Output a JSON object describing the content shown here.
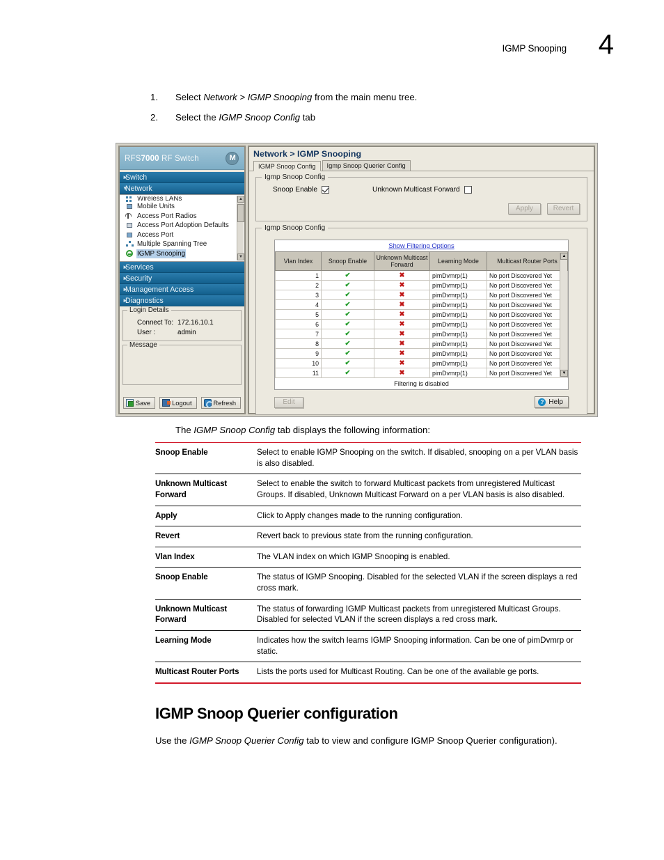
{
  "page": {
    "running_head": "IGMP Snooping",
    "chapter_number": "4"
  },
  "steps": [
    {
      "num": "1.",
      "pre": "Select ",
      "em1": "Network > IGMP Snooping",
      "post": " from the main menu tree."
    },
    {
      "num": "2.",
      "pre": "Select the ",
      "em1": "IGMP Snoop Config",
      "post": " tab"
    }
  ],
  "screenshot": {
    "brand": {
      "prefix": "RFS",
      "bold": "7000",
      "suffix": " RF Switch",
      "logo": "motorola-logo-icon"
    },
    "nav_groups": [
      {
        "label": "Switch",
        "expanded": false
      },
      {
        "label": "Network",
        "expanded": true
      },
      {
        "label": "Services",
        "expanded": false
      },
      {
        "label": "Security",
        "expanded": false
      },
      {
        "label": "Management Access",
        "expanded": false
      },
      {
        "label": "Diagnostics",
        "expanded": false
      }
    ],
    "tree_items": [
      {
        "label": "Wireless LANs",
        "selected": false,
        "icon": "wireless-lan-icon",
        "clipped": true
      },
      {
        "label": "Mobile Units",
        "selected": false,
        "icon": "mobile-unit-icon",
        "clipped": false
      },
      {
        "label": "Access Port Radios",
        "selected": false,
        "icon": "antenna-icon",
        "clipped": false
      },
      {
        "label": "Access Port Adoption Defaults",
        "selected": false,
        "icon": "adoption-defaults-icon",
        "clipped": false
      },
      {
        "label": "Access Port",
        "selected": false,
        "icon": "access-port-icon",
        "clipped": false
      },
      {
        "label": "Multiple Spanning Tree",
        "selected": false,
        "icon": "spanning-tree-icon",
        "clipped": false
      },
      {
        "label": "IGMP Snooping",
        "selected": true,
        "icon": "igmp-snooping-icon",
        "clipped": false
      }
    ],
    "login_details": {
      "legend": "Login Details",
      "connect_to_label": "Connect To:",
      "connect_to_value": "172.16.10.1",
      "user_label": "User :",
      "user_value": "admin"
    },
    "message_legend": "Message",
    "footer_buttons": [
      {
        "label": "Save",
        "icon": "save-icon"
      },
      {
        "label": "Logout",
        "icon": "logout-icon"
      },
      {
        "label": "Refresh",
        "icon": "refresh-icon"
      }
    ],
    "breadcrumb": "Network > IGMP Snooping",
    "tabs": [
      {
        "label": "IGMP Snoop Config",
        "active": true
      },
      {
        "label": "Igmp Snoop Querier Config",
        "active": false
      }
    ],
    "config_group": {
      "legend": "Igmp Snoop Config",
      "snoop_enable_label": "Snoop Enable",
      "snoop_enable_checked": true,
      "unknown_mcast_label": "Unknown Multicast Forward",
      "unknown_mcast_checked": false,
      "apply_label": "Apply",
      "revert_label": "Revert"
    },
    "table_group": {
      "legend": "Igmp Snoop Config",
      "filter_link": "Show Filtering Options",
      "columns": [
        "Vlan Index",
        "Snoop Enable",
        "Unknown Multicast Forward",
        "Learning Mode",
        "Multicast Router Ports"
      ],
      "rows": [
        {
          "vlan": "1",
          "snoop": "check",
          "umf": "cross",
          "mode": "pimDvmrp(1)",
          "ports": "No port Discovered Yet"
        },
        {
          "vlan": "2",
          "snoop": "check",
          "umf": "cross",
          "mode": "pimDvmrp(1)",
          "ports": "No port Discovered Yet"
        },
        {
          "vlan": "3",
          "snoop": "check",
          "umf": "cross",
          "mode": "pimDvmrp(1)",
          "ports": "No port Discovered Yet"
        },
        {
          "vlan": "4",
          "snoop": "check",
          "umf": "cross",
          "mode": "pimDvmrp(1)",
          "ports": "No port Discovered Yet"
        },
        {
          "vlan": "5",
          "snoop": "check",
          "umf": "cross",
          "mode": "pimDvmrp(1)",
          "ports": "No port Discovered Yet"
        },
        {
          "vlan": "6",
          "snoop": "check",
          "umf": "cross",
          "mode": "pimDvmrp(1)",
          "ports": "No port Discovered Yet"
        },
        {
          "vlan": "7",
          "snoop": "check",
          "umf": "cross",
          "mode": "pimDvmrp(1)",
          "ports": "No port Discovered Yet"
        },
        {
          "vlan": "8",
          "snoop": "check",
          "umf": "cross",
          "mode": "pimDvmrp(1)",
          "ports": "No port Discovered Yet"
        },
        {
          "vlan": "9",
          "snoop": "check",
          "umf": "cross",
          "mode": "pimDvmrp(1)",
          "ports": "No port Discovered Yet"
        },
        {
          "vlan": "10",
          "snoop": "check",
          "umf": "cross",
          "mode": "pimDvmrp(1)",
          "ports": "No port Discovered Yet"
        },
        {
          "vlan": "11",
          "snoop": "check",
          "umf": "cross",
          "mode": "pimDvmrp(1)",
          "ports": "No port Discovered Yet"
        }
      ],
      "footer_note": "Filtering is disabled",
      "edit_label": "Edit",
      "help_label": "Help"
    },
    "colors": {
      "brand_bar": "#8bb6cc",
      "nav_group": "#1b6896",
      "panel": "#ece9df",
      "check_green": "#1f9a27",
      "cross_red": "#c01818",
      "link_blue": "#2331c8"
    }
  },
  "caption": {
    "pre": "The ",
    "em": "IGMP Snoop Config",
    "post": " tab displays the following information:"
  },
  "definitions": [
    {
      "term": "Snoop Enable",
      "desc": "Select to enable IGMP Snooping on the switch. If disabled, snooping on a per VLAN basis is also disabled."
    },
    {
      "term": "Unknown Multicast Forward",
      "desc": "Select to enable the switch to forward Multicast packets from unregistered Multicast Groups. If disabled, Unknown Multicast Forward on a per VLAN basis is also disabled."
    },
    {
      "term": "Apply",
      "desc": "Click to Apply changes made to the running configuration."
    },
    {
      "term": "Revert",
      "desc": "Revert back to previous state from the running configuration."
    },
    {
      "term": "Vlan Index",
      "desc": "The VLAN index on which IGMP Snooping is enabled."
    },
    {
      "term": "Snoop Enable",
      "desc": "The status of IGMP Snooping. Disabled for the selected VLAN if the screen displays a red cross mark."
    },
    {
      "term": "Unknown Multicast Forward",
      "desc": "The status of forwarding IGMP Multicast packets from unregistered Multicast Groups. Disabled for selected VLAN if the screen displays a red cross mark."
    },
    {
      "term": "Learning Mode",
      "desc": "Indicates how the switch learns IGMP Snooping information. Can be one of pimDvmrp or static."
    },
    {
      "term": "Multicast Router Ports",
      "desc": "Lists the ports used for Multicast Routing. Can be one of the available ge ports."
    }
  ],
  "section": {
    "heading": "IGMP Snoop Querier configuration",
    "para_pre": "Use the ",
    "para_em": "IGMP Snoop Querier Config",
    "para_post": " tab to view and configure IGMP Snoop Querier configuration)."
  }
}
